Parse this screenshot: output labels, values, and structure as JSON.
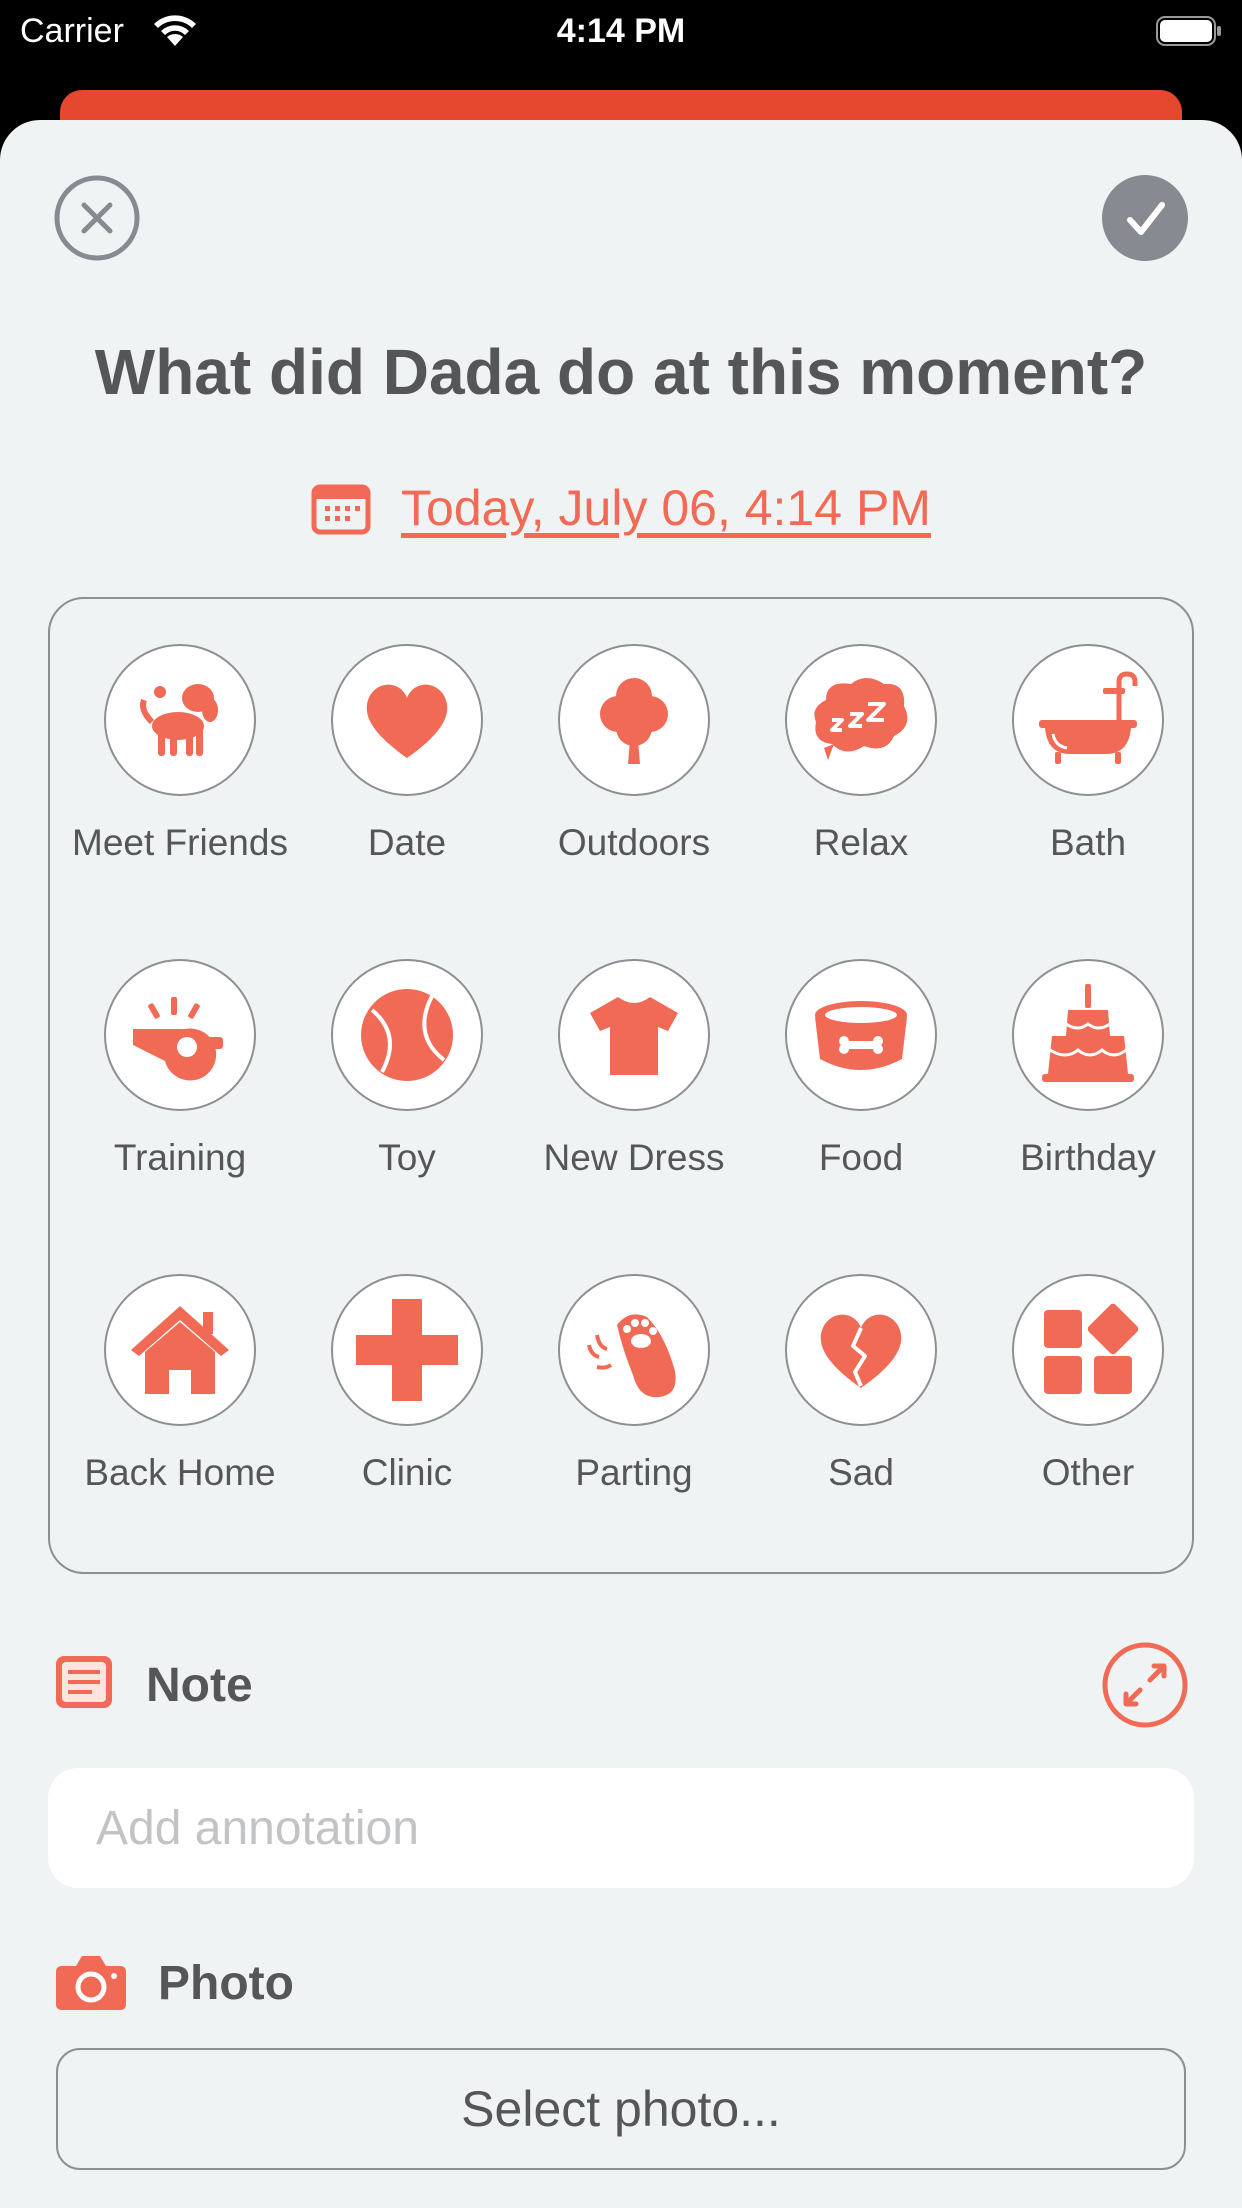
{
  "status_bar": {
    "carrier": "Carrier",
    "time": "4:14 PM"
  },
  "header": {
    "question": "What did Dada do at this moment?",
    "date": "Today, July 06, 4:14 PM"
  },
  "colors": {
    "accent": "#f06a55",
    "done_button": "#878b91",
    "background": "#f0f3f4",
    "text": "#555658"
  },
  "activities": [
    {
      "label": "Meet Friends",
      "icon": "dog-icon"
    },
    {
      "label": "Date",
      "icon": "heart-icon"
    },
    {
      "label": "Outdoors",
      "icon": "tree-icon"
    },
    {
      "label": "Relax",
      "icon": "sleep-bubble-icon"
    },
    {
      "label": "Bath",
      "icon": "bathtub-icon"
    },
    {
      "label": "Training",
      "icon": "whistle-icon"
    },
    {
      "label": "Toy",
      "icon": "ball-icon"
    },
    {
      "label": "New Dress",
      "icon": "shirt-icon"
    },
    {
      "label": "Food",
      "icon": "food-bowl-icon"
    },
    {
      "label": "Birthday",
      "icon": "cake-icon"
    },
    {
      "label": "Back Home",
      "icon": "house-icon"
    },
    {
      "label": "Clinic",
      "icon": "medical-cross-icon"
    },
    {
      "label": "Parting",
      "icon": "paw-wave-icon"
    },
    {
      "label": "Sad",
      "icon": "broken-heart-icon"
    },
    {
      "label": "Other",
      "icon": "grid-shapes-icon"
    }
  ],
  "note": {
    "title": "Note",
    "placeholder": "Add annotation",
    "value": ""
  },
  "photo": {
    "title": "Photo",
    "button_label": "Select photo..."
  }
}
